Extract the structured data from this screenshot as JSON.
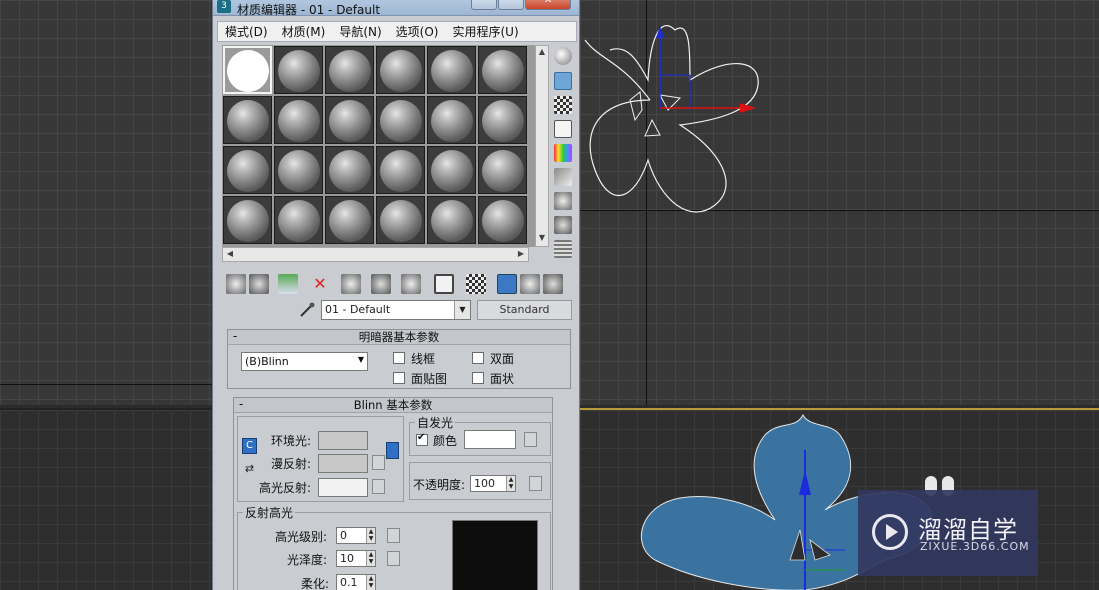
{
  "window": {
    "title": "材质编辑器 - 01 - Default"
  },
  "menu": [
    "模式(D)",
    "材质(M)",
    "导航(N)",
    "选项(O)",
    "实用程序(U)"
  ],
  "material": {
    "name": "01 - Default",
    "type": "Standard"
  },
  "shader_rollout": {
    "title": "明暗器基本参数",
    "collapse": "-",
    "shader": "(B)Blinn",
    "options": [
      {
        "label": "线框",
        "checked": false
      },
      {
        "label": "双面",
        "checked": false
      },
      {
        "label": "面贴图",
        "checked": false
      },
      {
        "label": "面状",
        "checked": false
      }
    ]
  },
  "blinn_rollout": {
    "title": "Blinn 基本参数",
    "collapse": "-",
    "ambient_label": "环境光:",
    "diffuse_label": "漫反射:",
    "specular_label": "高光反射:",
    "lock_glyph": "C",
    "self_illum": {
      "title": "自发光",
      "color_label": "颜色",
      "checked": true
    },
    "opacity": {
      "label": "不透明度:",
      "value": "100"
    },
    "specular_highlights": {
      "title": "反射高光",
      "level_label": "高光级别:",
      "level_value": "0",
      "gloss_label": "光泽度:",
      "gloss_value": "10",
      "soften_label": "柔化:",
      "soften_value": "0.1"
    }
  },
  "colors": {
    "ambient": "#c8c8c8",
    "diffuse": "#c8c8c8",
    "specular": "#f2f2f2",
    "self_illum_color": "#ffffff",
    "flower_fill": "#3a73a0",
    "highlight_preview": "#0d0d0d"
  },
  "watermark": {
    "brand": "溜溜自学",
    "site": "ZIXUE.3D66.COM"
  }
}
